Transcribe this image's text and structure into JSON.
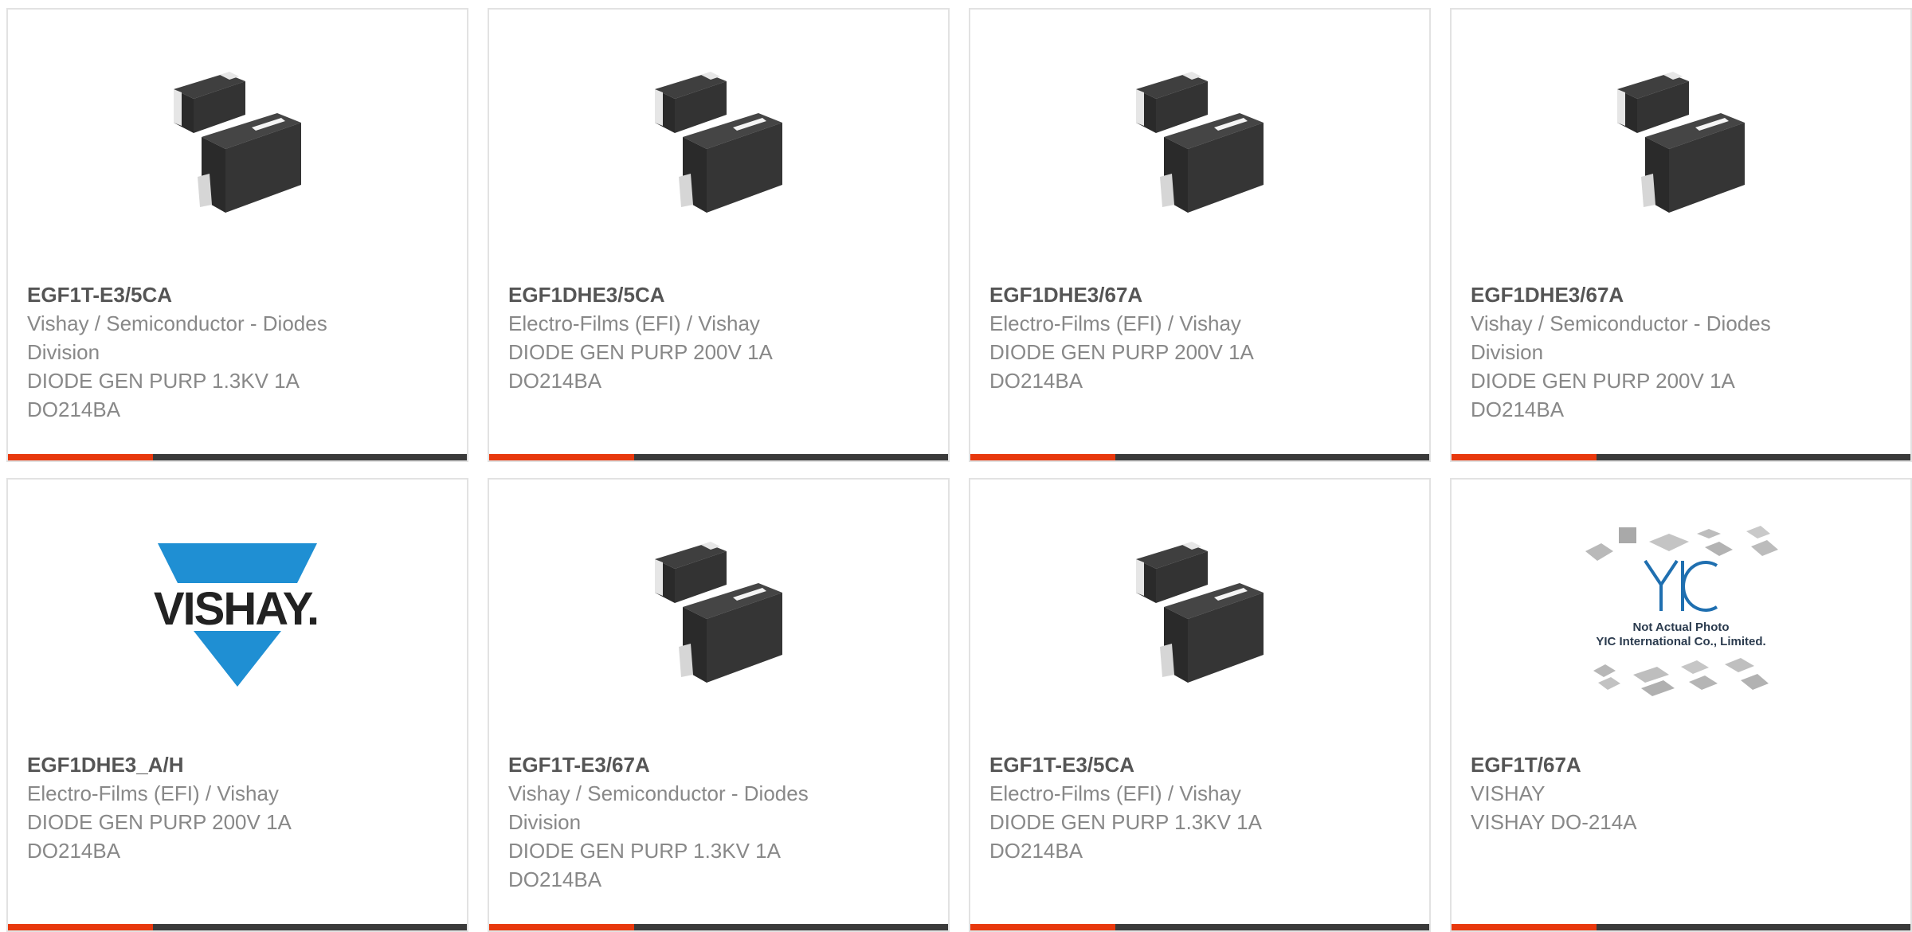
{
  "colors": {
    "accent": "#e8380d",
    "bar": "#3a3a3a",
    "part_number": "#555555",
    "detail_text": "#888888",
    "vishay_blue": "#1f8fd3"
  },
  "products": [
    {
      "part_number": "EGF1T-E3/5CA",
      "manufacturer": "Vishay / Semiconductor - Diodes\nDivision",
      "description": "DIODE GEN PURP 1.3KV 1A\nDO214BA",
      "image": "diode-package-image"
    },
    {
      "part_number": "EGF1DHE3/5CA",
      "manufacturer": "Electro-Films (EFI) / Vishay",
      "description": "DIODE GEN PURP 200V 1A\nDO214BA",
      "image": "diode-package-image"
    },
    {
      "part_number": "EGF1DHE3/67A",
      "manufacturer": "Electro-Films (EFI) / Vishay",
      "description": "DIODE GEN PURP 200V 1A\nDO214BA",
      "image": "diode-package-image"
    },
    {
      "part_number": "EGF1DHE3/67A",
      "manufacturer": "Vishay / Semiconductor - Diodes\nDivision",
      "description": "DIODE GEN PURP 200V 1A\nDO214BA",
      "image": "diode-package-image"
    },
    {
      "part_number": "EGF1DHE3_A/H",
      "manufacturer": "Electro-Films (EFI) / Vishay",
      "description": "DIODE GEN PURP 200V 1A\nDO214BA",
      "image": "vishay-logo",
      "logo_text": "VISHAY."
    },
    {
      "part_number": "EGF1T-E3/67A",
      "manufacturer": "Vishay / Semiconductor - Diodes\nDivision",
      "description": "DIODE GEN PURP 1.3KV 1A\nDO214BA",
      "image": "diode-package-image"
    },
    {
      "part_number": "EGF1T-E3/5CA",
      "manufacturer": "Electro-Films (EFI) / Vishay",
      "description": "DIODE GEN PURP 1.3KV 1A\nDO214BA",
      "image": "diode-package-image"
    },
    {
      "part_number": "EGF1T/67A",
      "manufacturer": "VISHAY",
      "description": "VISHAY DO-214A",
      "image": "not-actual-photo-placeholder",
      "placeholder_lines": [
        "Not Actual Photo",
        "YIC International Co., Limited."
      ]
    }
  ]
}
